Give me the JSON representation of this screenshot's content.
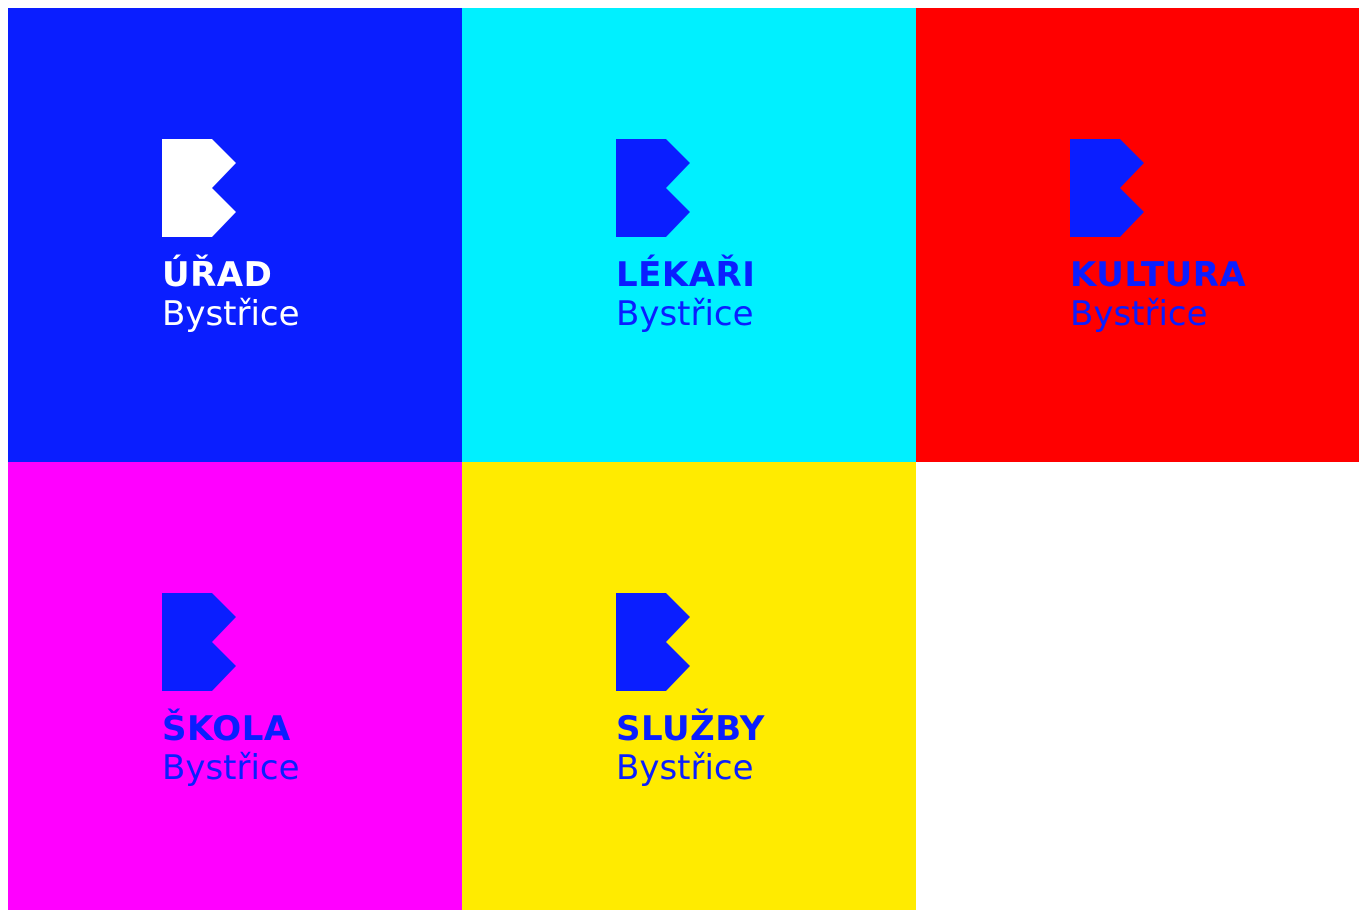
{
  "colors": {
    "blue": "#0a1eff",
    "cyan": "#00f0ff",
    "red": "#ff0000",
    "magenta": "#ff00ff",
    "yellow": "#ffeb00",
    "white": "#ffffff"
  },
  "tiles": [
    {
      "title": "ÚŘAD",
      "subtitle": "Bystřice",
      "background": "#0a1eff",
      "foreground": "#ffffff"
    },
    {
      "title": "LÉKAŘI",
      "subtitle": "Bystřice",
      "background": "#00f0ff",
      "foreground": "#0a1eff"
    },
    {
      "title": "KULTURA",
      "subtitle": "Bystřice",
      "background": "#ff0000",
      "foreground": "#0a1eff"
    },
    {
      "title": "ŠKOLA",
      "subtitle": "Bystřice",
      "background": "#ff00ff",
      "foreground": "#0a1eff"
    },
    {
      "title": "SLUŽBY",
      "subtitle": "Bystřice",
      "background": "#ffeb00",
      "foreground": "#0a1eff"
    }
  ],
  "icons": {
    "logo": "b-logo-icon"
  }
}
